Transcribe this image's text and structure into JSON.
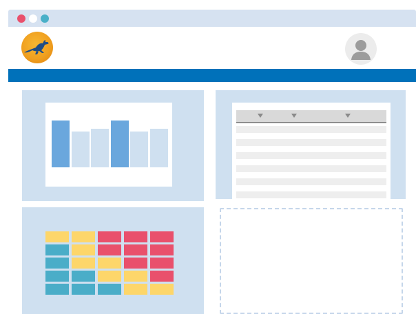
{
  "colors": {
    "titlebar": "#d6e2f1",
    "navbar": "#0071ba",
    "panel": "#cfe0f0",
    "bar_dark": "#6aa7dd",
    "bar_light": "#cfe0f0",
    "heat_red": "#e9506c",
    "heat_yellow": "#fdd66a",
    "heat_teal": "#4aadc8"
  },
  "window": {
    "controls": [
      "close-dot",
      "minimize-dot",
      "maximize-dot"
    ]
  },
  "header": {
    "logo_icon": "kangaroo-logo-icon",
    "avatar_icon": "user-avatar-icon"
  },
  "widgets": {
    "bar_chart": {
      "bars": [
        {
          "value": 1.0,
          "tone": "dark"
        },
        {
          "value": 0.76,
          "tone": "light"
        },
        {
          "value": 0.82,
          "tone": "light"
        },
        {
          "value": 1.0,
          "tone": "dark"
        },
        {
          "value": 0.76,
          "tone": "light"
        },
        {
          "value": 0.82,
          "tone": "light"
        }
      ]
    },
    "table": {
      "header_icons": [
        "sort-arrow-icon",
        "sort-arrow-icon",
        "sort-arrow-icon"
      ],
      "row_count": 6
    },
    "heatmap": {
      "rows": [
        [
          "yellow",
          "yellow",
          "red",
          "red",
          "red"
        ],
        [
          "teal",
          "yellow",
          "red",
          "red",
          "red"
        ],
        [
          "teal",
          "yellow",
          "yellow",
          "red",
          "red"
        ],
        [
          "teal",
          "teal",
          "yellow",
          "yellow",
          "red"
        ],
        [
          "teal",
          "teal",
          "teal",
          "yellow",
          "yellow"
        ]
      ]
    }
  }
}
